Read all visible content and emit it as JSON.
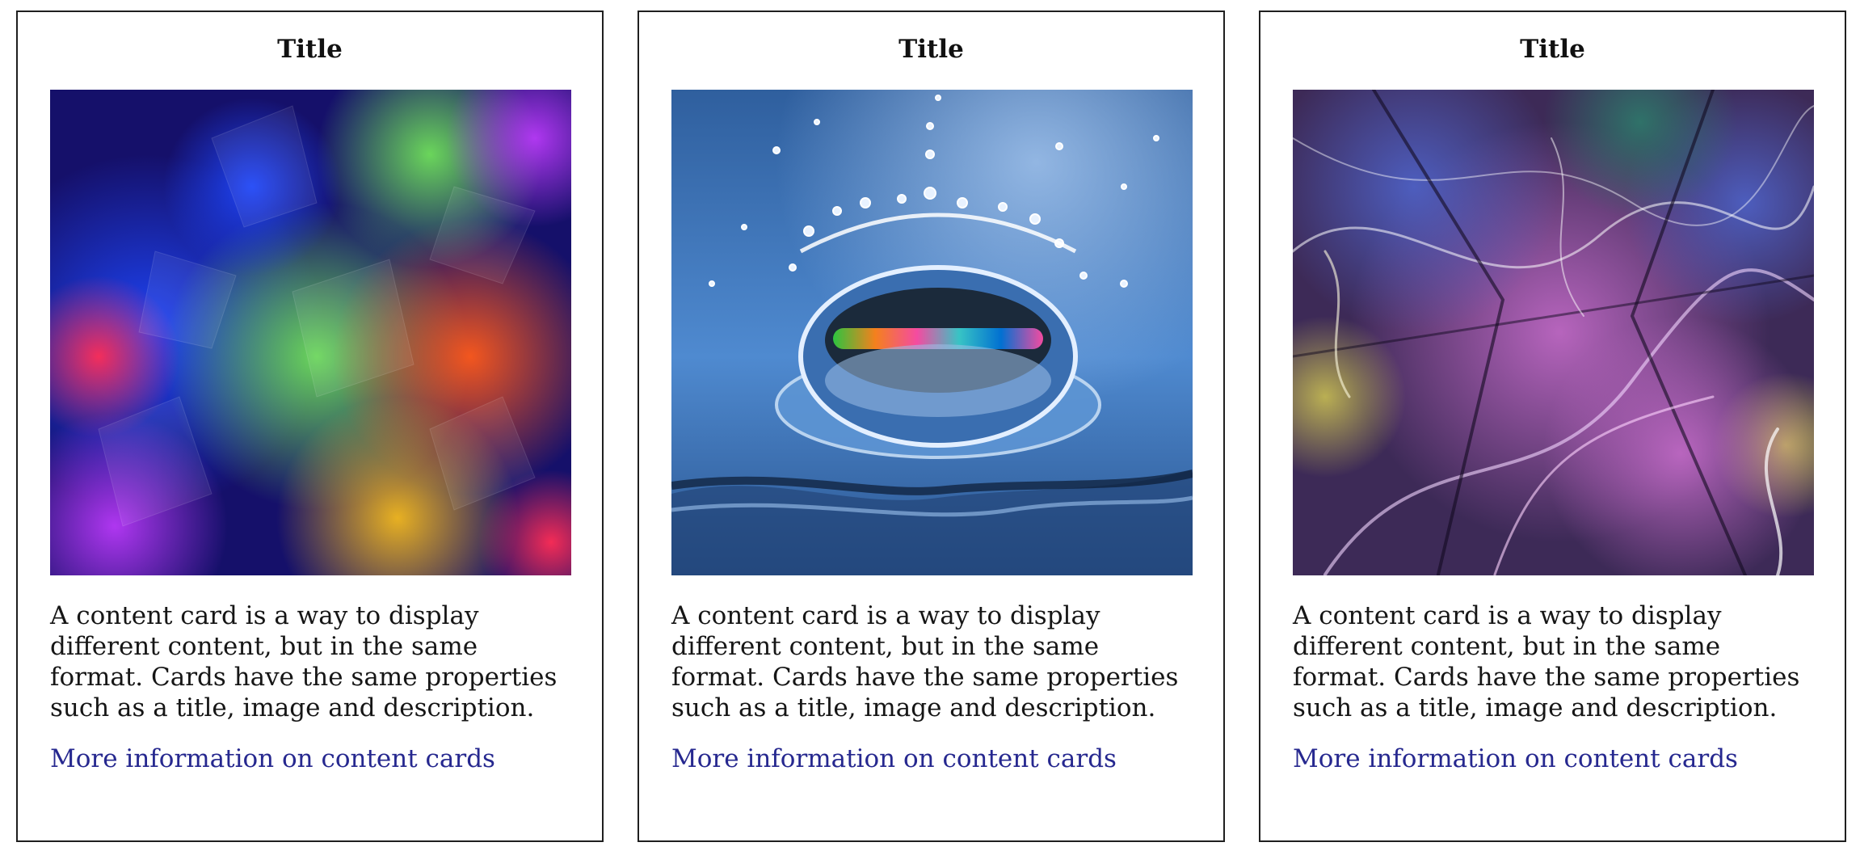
{
  "cards": [
    {
      "title": "Title",
      "image_name": "abstract-polygon-image",
      "description": "A content card is a way to display different content, but in the same format. Cards have the same properties such as a title, image and description.",
      "link_label": "More information on content cards"
    },
    {
      "title": "Title",
      "image_name": "water-splash-image",
      "description": "A content card is a way to display different content, but in the same format. Cards have the same properties such as a title, image and description.",
      "link_label": "More information on content cards"
    },
    {
      "title": "Title",
      "image_name": "abstract-fractal-image",
      "description": "A content card is a way to display different content, but in the same format. Cards have the same properties such as a title, image and description.",
      "link_label": "More information on content cards"
    }
  ],
  "colors": {
    "link": "#26288f",
    "border": "#1f1f1f",
    "text": "#161616"
  }
}
